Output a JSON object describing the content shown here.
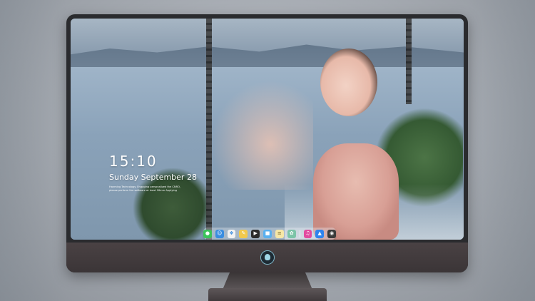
{
  "lockscreen": {
    "time": "15:10",
    "date": "Sunday September 28",
    "notice_lines": [
      "Hanming Technology. Engaging personalized the CNRO,",
      "please perform the software at least 18mm Applying"
    ]
  },
  "dock": {
    "icons": [
      {
        "name": "messages-icon",
        "color": "#3bc45a"
      },
      {
        "name": "finder-icon",
        "color": "#3a8de0"
      },
      {
        "name": "safari-icon",
        "color": "#f2f2f2"
      },
      {
        "name": "notes-icon",
        "color": "#f2c94c"
      },
      {
        "name": "clapper-icon",
        "color": "#2b2b2b"
      },
      {
        "name": "files-icon",
        "color": "#5ab0ef"
      },
      {
        "name": "notepad-icon",
        "color": "#f6e7a6"
      },
      {
        "name": "photos-icon",
        "color": "#7cc4a8"
      },
      {
        "name": "itunes-icon",
        "color": "#e24aa0"
      },
      {
        "name": "app-store-icon",
        "color": "#2f84ee"
      },
      {
        "name": "camera-icon",
        "color": "#3b3b3b"
      }
    ]
  }
}
